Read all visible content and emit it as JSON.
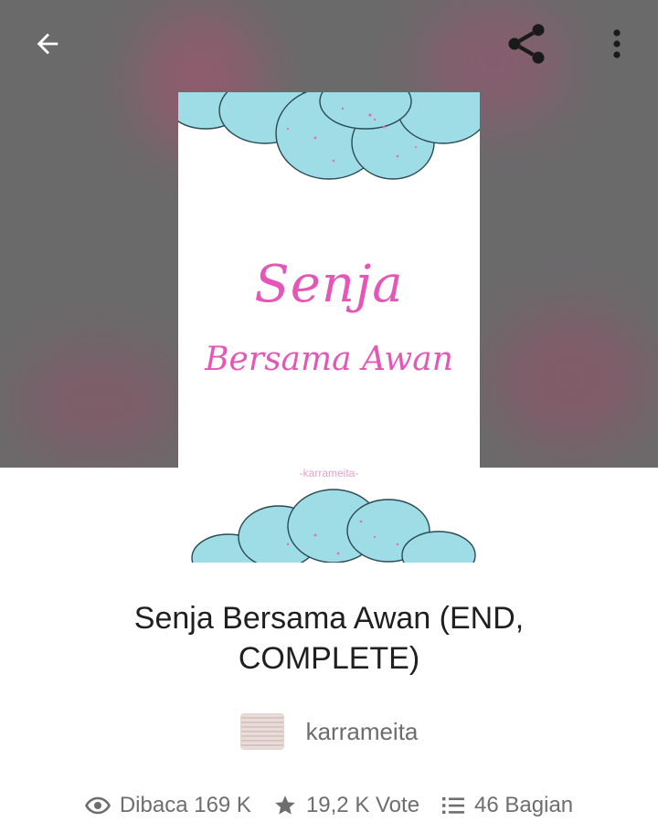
{
  "toolbar": {
    "back_icon": "arrow-left-icon",
    "share_icon": "share-icon",
    "more_icon": "more-vertical-icon"
  },
  "cover": {
    "title_line1": "Senja",
    "title_line2": "Bersama Awan",
    "author": "-karrameita-"
  },
  "book": {
    "title": "Senja Bersama Awan (END, COMPLETE)",
    "author": "karrameita"
  },
  "stats": {
    "reads": "Dibaca 169 K",
    "votes": "19,2 K Vote",
    "parts": "46 Bagian"
  },
  "colors": {
    "hero_background": "#6b6a6b",
    "cover_title": "#e457b6",
    "cloud": "#9fdde6",
    "text_primary": "#1f1f1f",
    "text_secondary": "#6e6e6e"
  }
}
